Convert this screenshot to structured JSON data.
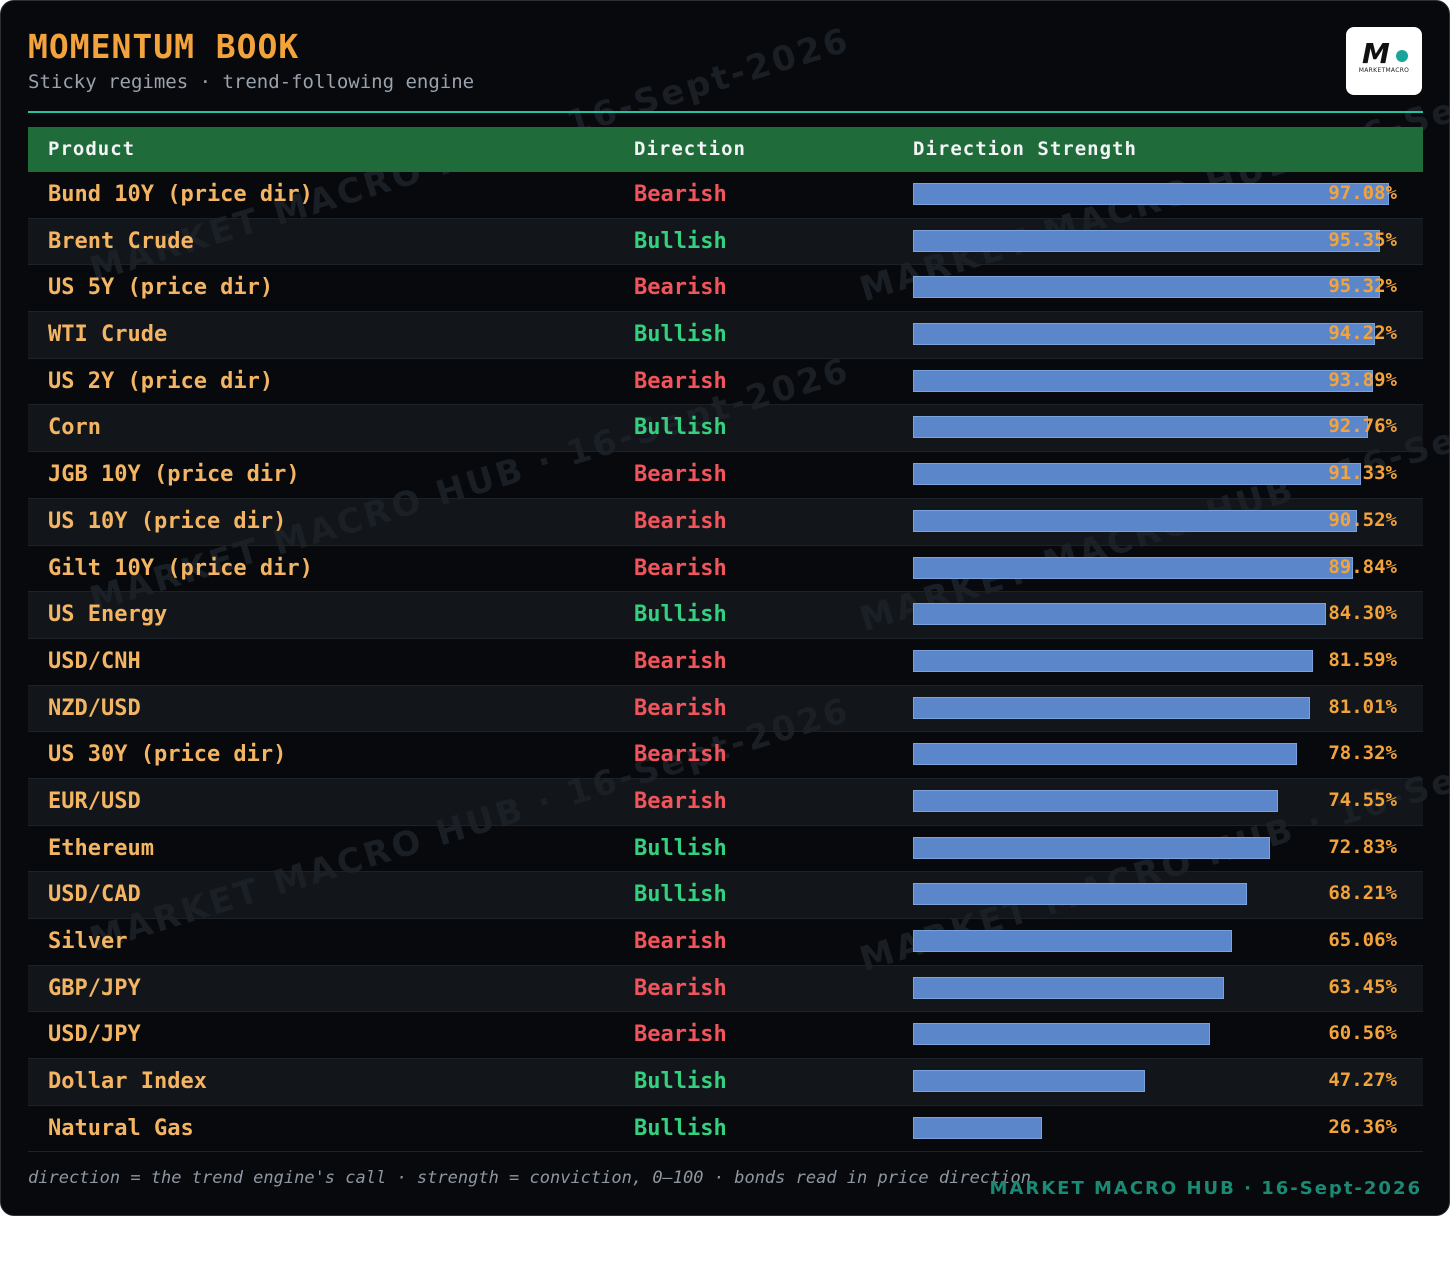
{
  "header": {
    "title": "MOMENTUM BOOK",
    "subtitle": "Sticky regimes · trend-following engine"
  },
  "logo": {
    "mark": "M",
    "text": "MARKETMACRO"
  },
  "watermark_text": "MARKET MACRO HUB · 16-Sept-2026",
  "colors": {
    "accent": "#f3a33c",
    "header_bg": "#1f6b3a",
    "rule": "#23c4a4",
    "bearish": "#f2545b",
    "bullish": "#35d07f",
    "bar": "#5b86c9",
    "brand": "#1b8a74"
  },
  "table": {
    "columns": [
      "Product",
      "Direction",
      "Direction Strength"
    ]
  },
  "chart_data": {
    "type": "bar",
    "orientation": "horizontal",
    "xlim": [
      0,
      100
    ],
    "value_format": "percent",
    "rows": [
      {
        "product": "Bund 10Y (price dir)",
        "direction": "Bearish",
        "strength": 97.08,
        "label": "97.08%"
      },
      {
        "product": "Brent Crude",
        "direction": "Bullish",
        "strength": 95.35,
        "label": "95.35%"
      },
      {
        "product": "US 5Y (price dir)",
        "direction": "Bearish",
        "strength": 95.32,
        "label": "95.32%"
      },
      {
        "product": "WTI Crude",
        "direction": "Bullish",
        "strength": 94.22,
        "label": "94.22%"
      },
      {
        "product": "US 2Y (price dir)",
        "direction": "Bearish",
        "strength": 93.89,
        "label": "93.89%"
      },
      {
        "product": "Corn",
        "direction": "Bullish",
        "strength": 92.76,
        "label": "92.76%"
      },
      {
        "product": "JGB 10Y (price dir)",
        "direction": "Bearish",
        "strength": 91.33,
        "label": "91.33%"
      },
      {
        "product": "US 10Y (price dir)",
        "direction": "Bearish",
        "strength": 90.52,
        "label": "90.52%"
      },
      {
        "product": "Gilt 10Y (price dir)",
        "direction": "Bearish",
        "strength": 89.84,
        "label": "89.84%"
      },
      {
        "product": "US Energy",
        "direction": "Bullish",
        "strength": 84.3,
        "label": "84.30%"
      },
      {
        "product": "USD/CNH",
        "direction": "Bearish",
        "strength": 81.59,
        "label": "81.59%"
      },
      {
        "product": "NZD/USD",
        "direction": "Bearish",
        "strength": 81.01,
        "label": "81.01%"
      },
      {
        "product": "US 30Y (price dir)",
        "direction": "Bearish",
        "strength": 78.32,
        "label": "78.32%"
      },
      {
        "product": "EUR/USD",
        "direction": "Bearish",
        "strength": 74.55,
        "label": "74.55%"
      },
      {
        "product": "Ethereum",
        "direction": "Bullish",
        "strength": 72.83,
        "label": "72.83%"
      },
      {
        "product": "USD/CAD",
        "direction": "Bullish",
        "strength": 68.21,
        "label": "68.21%"
      },
      {
        "product": "Silver",
        "direction": "Bearish",
        "strength": 65.06,
        "label": "65.06%"
      },
      {
        "product": "GBP/JPY",
        "direction": "Bearish",
        "strength": 63.45,
        "label": "63.45%"
      },
      {
        "product": "USD/JPY",
        "direction": "Bearish",
        "strength": 60.56,
        "label": "60.56%"
      },
      {
        "product": "Dollar Index",
        "direction": "Bullish",
        "strength": 47.27,
        "label": "47.27%"
      },
      {
        "product": "Natural Gas",
        "direction": "Bullish",
        "strength": 26.36,
        "label": "26.36%"
      }
    ]
  },
  "footer": {
    "note": "direction = the trend engine's call · strength = conviction, 0–100 · bonds read in price direction",
    "brand": "MARKET MACRO HUB · 16-Sept-2026"
  }
}
